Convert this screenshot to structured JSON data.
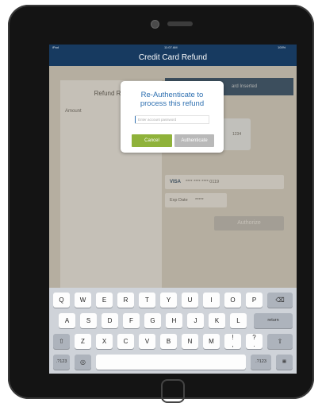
{
  "status_bar": {
    "carrier": "iPad",
    "time": "11:07 AM",
    "battery": "100%"
  },
  "nav": {
    "title": "Credit Card Refund"
  },
  "left_panel": {
    "title": "Refund Req",
    "amount_label": "Amount"
  },
  "right_banner": "ard Inserted",
  "card_preview": {
    "last_digits": "1234"
  },
  "card_row": {
    "brand": "VISA",
    "masked_number": "**** **** **** 0119"
  },
  "exp_row": {
    "label": "Exp Date",
    "value": "*****"
  },
  "authorize_label": "Authorize",
  "modal": {
    "title_line1": "Re-Authenticate to",
    "title_line2": "process this refund",
    "password_placeholder": "Enter account password",
    "cancel_label": "Cancel",
    "authenticate_label": "Authenticate"
  },
  "keyboard": {
    "row1": [
      "Q",
      "W",
      "E",
      "R",
      "T",
      "Y",
      "U",
      "I",
      "O",
      "P"
    ],
    "row2": [
      "A",
      "S",
      "D",
      "F",
      "G",
      "H",
      "J",
      "K",
      "L"
    ],
    "row3": [
      "Z",
      "X",
      "C",
      "V",
      "B",
      "N",
      "M",
      "!",
      ",",
      "?",
      "."
    ],
    "return_label": "return",
    "numbers_label": ".?123"
  },
  "colors": {
    "nav_bg": "#173a60",
    "modal_title": "#2d6fb0",
    "cancel_bg": "#8fb23a",
    "authenticate_bg": "#b9b9b9"
  }
}
